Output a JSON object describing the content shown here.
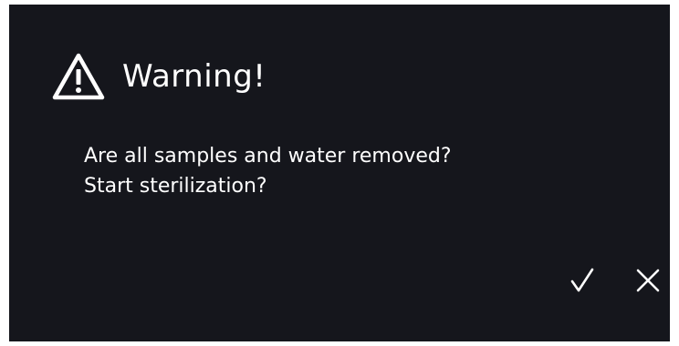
{
  "dialog": {
    "title": "Warning!",
    "title_icon": "warning-triangle-icon",
    "message_lines": [
      "Are all samples and water removed?",
      "Start sterilization?"
    ],
    "actions": {
      "confirm_icon": "checkmark-icon",
      "cancel_icon": "close-icon"
    }
  },
  "colors": {
    "background": "#15161c",
    "foreground": "#ffffff"
  }
}
